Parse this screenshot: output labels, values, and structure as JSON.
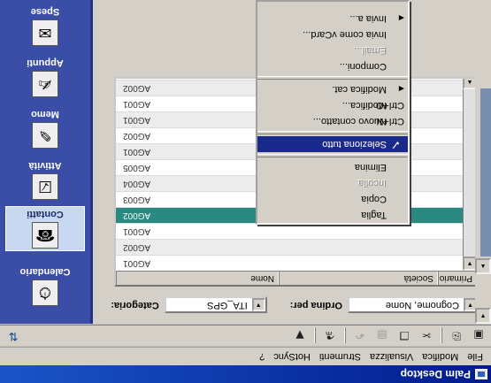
{
  "window": {
    "title": "Palm Desktop"
  },
  "menu": [
    "File",
    "Modifica",
    "Visualizza",
    "Strumenti",
    "HotSync",
    "?"
  ],
  "toolbar": {
    "icons": [
      "save-icon",
      "print-icon",
      "cut-icon",
      "copy-icon",
      "paste-icon",
      "undo-icon",
      "find-icon",
      "install-icon"
    ],
    "right_icon": "hotsync-icon"
  },
  "filters": {
    "category_label": "Categoria:",
    "category_value": "ITA_GPS",
    "sort_label": "Ordina per:",
    "sort_value": "Cognome, Nome"
  },
  "table": {
    "headers": [
      "Nome",
      "Società",
      "Primario"
    ],
    "rows": [
      "AG001",
      "AG002",
      "AG001",
      "AG002",
      "AG003",
      "AG004",
      "AG005",
      "AG001",
      "AG002",
      "AG001",
      "AG001",
      "AG002",
      "AG003",
      "AG004",
      "AG005",
      "AG006",
      "AG002"
    ],
    "selected_index": 3
  },
  "launcher": {
    "items": [
      "Calendario",
      "Contatti",
      "Attività",
      "Memo",
      "Appunti",
      "Spese"
    ],
    "active": "Contatti"
  },
  "context_menu": {
    "items": [
      {
        "label": "Taglia",
        "enabled": true
      },
      {
        "label": "Copia",
        "enabled": true
      },
      {
        "label": "Incolla",
        "enabled": false
      },
      {
        "label": "Elimina",
        "enabled": true
      },
      {
        "sep": true
      },
      {
        "label": "Seleziona tutto",
        "enabled": true,
        "highlighted": true
      },
      {
        "sep": true
      },
      {
        "label": "Nuovo contatto...",
        "shortcut": "Ctrl+N",
        "enabled": true
      },
      {
        "label": "Modifica...",
        "shortcut": "Ctrl+O",
        "enabled": true
      },
      {
        "label": "Modifica cat.",
        "submenu": true,
        "enabled": true
      },
      {
        "sep": true
      },
      {
        "label": "Componi...",
        "enabled": true
      },
      {
        "label": "Email...",
        "enabled": false
      },
      {
        "label": "Invia come vCard...",
        "enabled": true
      },
      {
        "label": "Invia a...",
        "submenu": true,
        "enabled": true
      }
    ]
  }
}
